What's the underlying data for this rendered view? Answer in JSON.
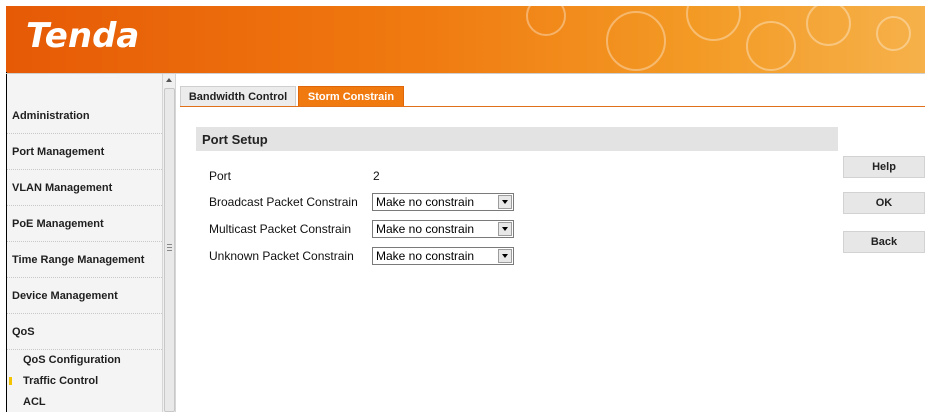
{
  "header": {
    "logo_text": "Tenda",
    "brand_color": "#F07A10"
  },
  "sidebar": {
    "items": [
      {
        "label": "Administration"
      },
      {
        "label": "Port Management"
      },
      {
        "label": "VLAN Management"
      },
      {
        "label": "PoE Management"
      },
      {
        "label": "Time Range Management"
      },
      {
        "label": "Device Management"
      },
      {
        "label": "QoS"
      }
    ],
    "sub_items": [
      {
        "label": "QoS Configuration"
      },
      {
        "label": "Traffic Control",
        "active": true
      },
      {
        "label": "ACL"
      }
    ]
  },
  "tabs": [
    {
      "label": "Bandwidth Control",
      "active": false
    },
    {
      "label": "Storm Constrain",
      "active": true
    }
  ],
  "section": {
    "title": "Port Setup",
    "port_label": "Port",
    "port_value": "2",
    "rows": [
      {
        "label": "Broadcast Packet Constrain",
        "value": "Make no constrain"
      },
      {
        "label": "Multicast Packet Constrain",
        "value": "Make no constrain"
      },
      {
        "label": "Unknown Packet Constrain",
        "value": "Make no constrain"
      }
    ]
  },
  "buttons": {
    "help": "Help",
    "ok": "OK",
    "back": "Back"
  }
}
